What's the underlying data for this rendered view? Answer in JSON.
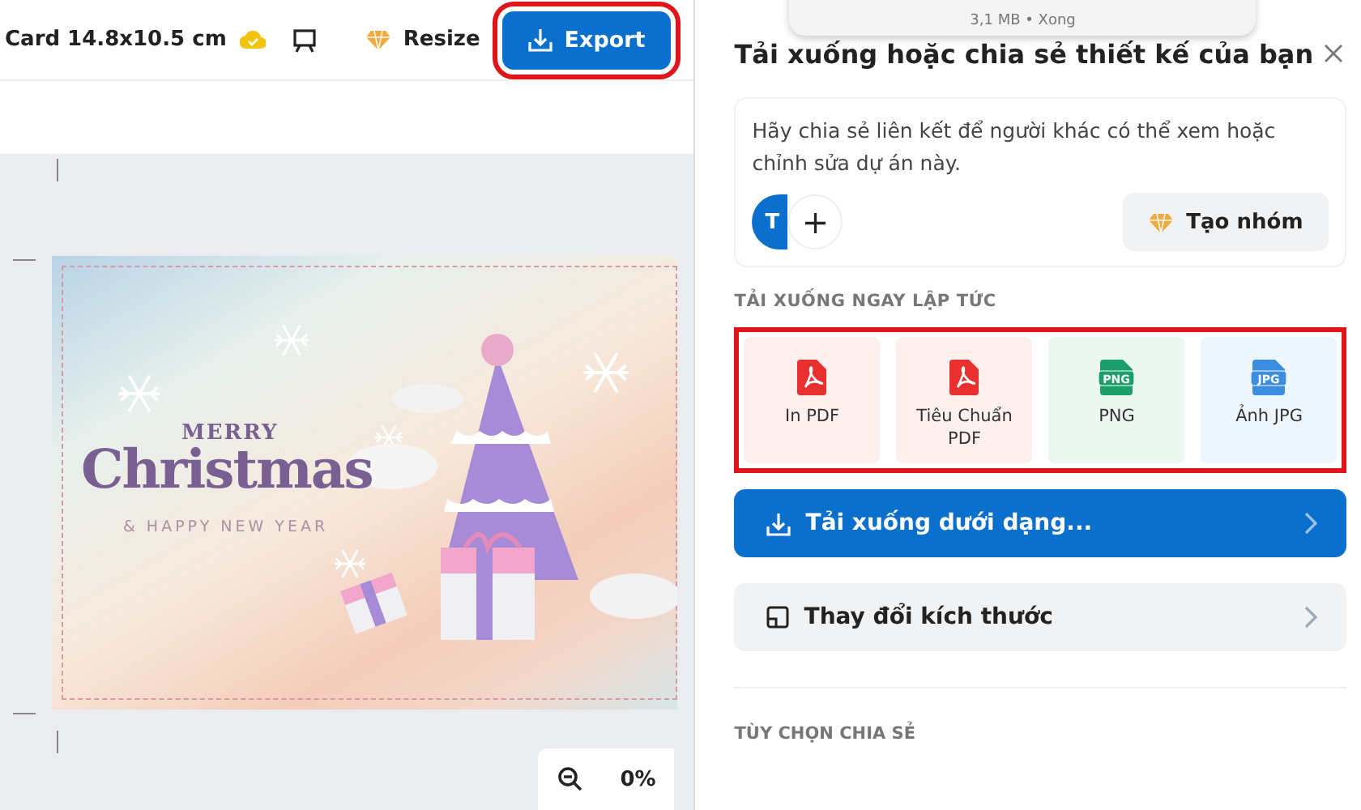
{
  "toolbar": {
    "title": "Card 14.8x10.5 cm",
    "resize": "Resize",
    "export": {
      "label": "Export",
      "highlighted": true
    }
  },
  "card": {
    "line_1": "MERRY",
    "line_2": "Christmas",
    "line_3": "& HAPPY NEW YEAR"
  },
  "zoom": {
    "value": "0%"
  },
  "toast": {
    "text": "3,1 MB • Xong"
  },
  "panel": {
    "title": "Tải xuống hoặc chia sẻ thiết kế của bạn",
    "share": {
      "text": "Hãy chia sẻ liên kết để người khác có thể xem hoặc chỉnh sửa dự án này.",
      "avatar": "T",
      "add": "+",
      "team_button": "Tạo nhóm"
    },
    "download_heading": "TẢI XUỐNG NGAY LẬP TỨC",
    "formats_highlighted": true,
    "formats": [
      {
        "kind": "pdf",
        "label": "In PDF"
      },
      {
        "kind": "pdf",
        "label": "Tiêu Chuẩn PDF"
      },
      {
        "kind": "png",
        "badge": "PNG",
        "label": "PNG"
      },
      {
        "kind": "jpg",
        "badge": "JPG",
        "label": "Ảnh JPG"
      }
    ],
    "download_as": "Tải xuống dưới dạng...",
    "resize": "Thay đổi kích thước",
    "share_heading": "TÙY CHỌN CHIA SẺ"
  }
}
